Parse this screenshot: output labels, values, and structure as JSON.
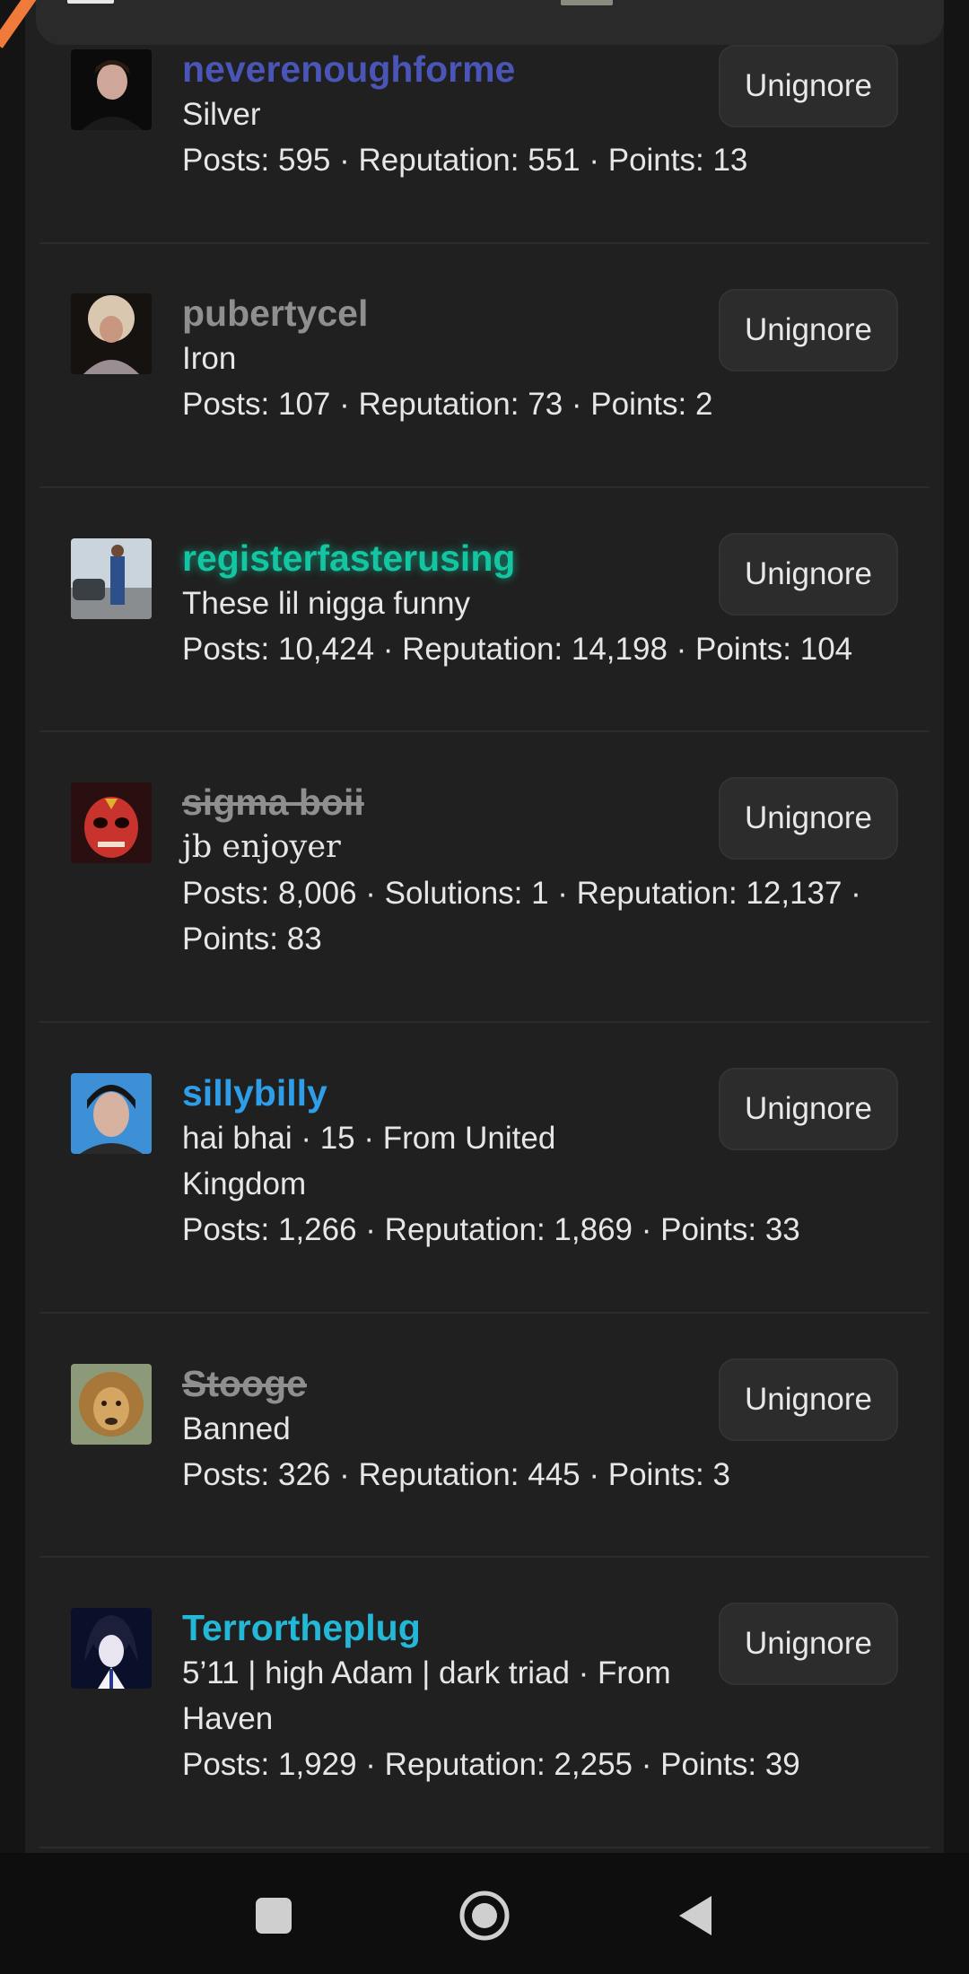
{
  "colors": {
    "background": "#181818",
    "panel": "#202020",
    "button_bg": "#2c2c2c",
    "text": "#e6e6e6",
    "name_blue_dark": "#4a55b8",
    "name_gray": "#8f8f8f",
    "name_green": "#13c5a0",
    "name_blue": "#2f9ee8",
    "name_cyan": "#23b8d8"
  },
  "members": [
    {
      "name": "neverenoughforme",
      "title": "Silver",
      "stats": "Posts: 595 · Reputation: 551 · Points: 13",
      "button": "Unignore",
      "avatar_icon": "avatar-dark-hair-icon"
    },
    {
      "name": "pubertycel",
      "title": "Iron",
      "stats": "Posts: 107 · Reputation: 73 · Points: 2",
      "button": "Unignore",
      "avatar_icon": "avatar-fur-hat-icon"
    },
    {
      "name": "registerfasterusing",
      "title": "These lil nigga funny",
      "stats": "Posts: 10,424 · Reputation: 14,198 · Points: 104",
      "button": "Unignore",
      "avatar_icon": "avatar-car-photo-icon"
    },
    {
      "name": "sigma boii",
      "title": "jb enjoyer",
      "stats": "Posts: 8,006 · Solutions: 1 · Reputation: 12,137 · Points: 83",
      "button": "Unignore",
      "avatar_icon": "avatar-red-mask-icon"
    },
    {
      "name": "sillybilly",
      "title": "hai bhai · 15 · From United Kingdom",
      "stats": "Posts: 1,266 · Reputation: 1,869 · Points: 33",
      "button": "Unignore",
      "avatar_icon": "avatar-face-icon"
    },
    {
      "name": "Stooge",
      "title": "Banned",
      "stats": "Posts: 326 · Reputation: 445 · Points: 3",
      "button": "Unignore",
      "avatar_icon": "avatar-lion-icon"
    },
    {
      "name": "Terrortheplug",
      "title": "5’11 | high Adam | dark triad · From Haven",
      "stats": "Posts: 1,929 · Reputation: 2,255 · Points: 39",
      "button": "Unignore",
      "avatar_icon": "avatar-anime-icon"
    }
  ],
  "nav": {
    "recents": "square-icon",
    "home": "circle-home-icon",
    "back": "triangle-back-icon"
  }
}
